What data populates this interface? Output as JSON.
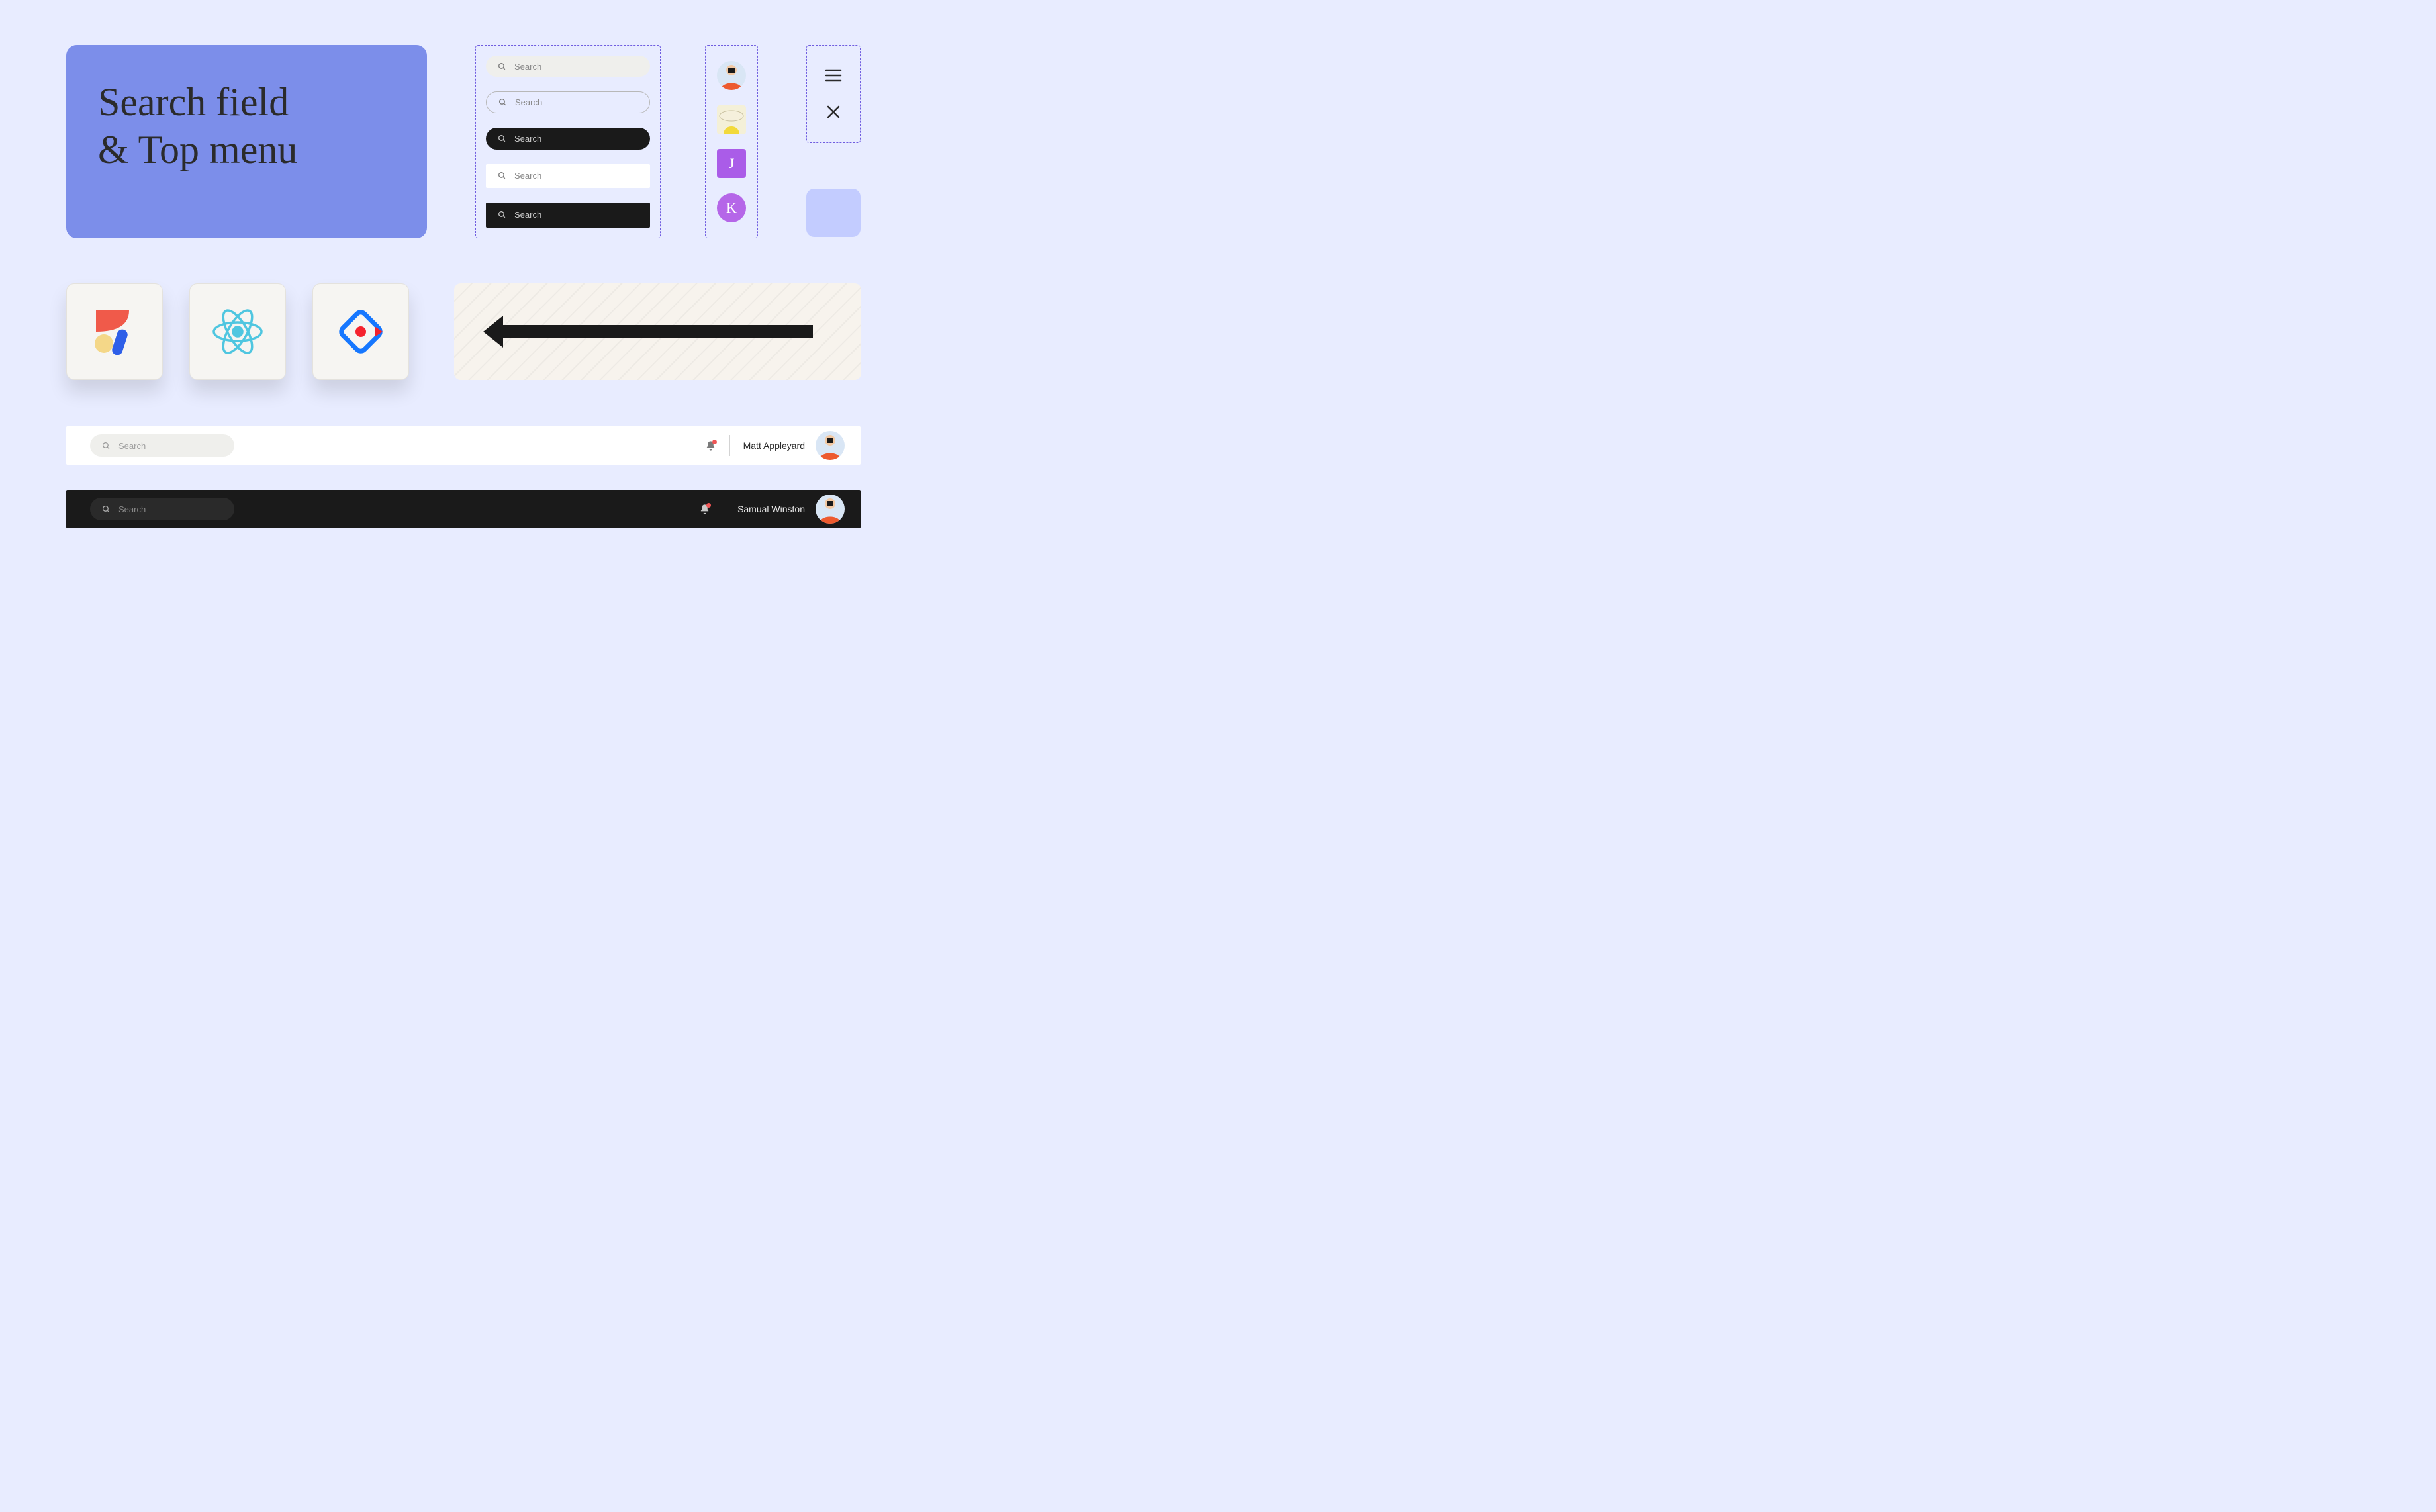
{
  "hero": {
    "title_line1": "Search field",
    "title_line2": "& Top menu"
  },
  "search_variants": [
    {
      "placeholder": "Search"
    },
    {
      "placeholder": "Search"
    },
    {
      "placeholder": "Search"
    },
    {
      "placeholder": "Search"
    },
    {
      "placeholder": "Search"
    }
  ],
  "avatars": {
    "a1": {
      "kind": "illustration",
      "bg": "#d9e6f5"
    },
    "a2": {
      "kind": "illustration",
      "bg": "#f4f0d8"
    },
    "a3": {
      "kind": "letter",
      "letter": "J",
      "bg": "#aa5ce8"
    },
    "a4": {
      "kind": "letter",
      "letter": "K",
      "bg": "#b566e8"
    }
  },
  "menu_icons": {
    "hamburger": "hamburger-icon",
    "close": "close-icon"
  },
  "swatch": {
    "color": "#c3ccff"
  },
  "logos": [
    "abstract-shapes",
    "react",
    "ant-design"
  ],
  "topbar_light": {
    "search_placeholder": "Search",
    "user_name": "Matt Appleyard"
  },
  "topbar_dark": {
    "search_placeholder": "Search",
    "user_name": "Samual Winston"
  }
}
